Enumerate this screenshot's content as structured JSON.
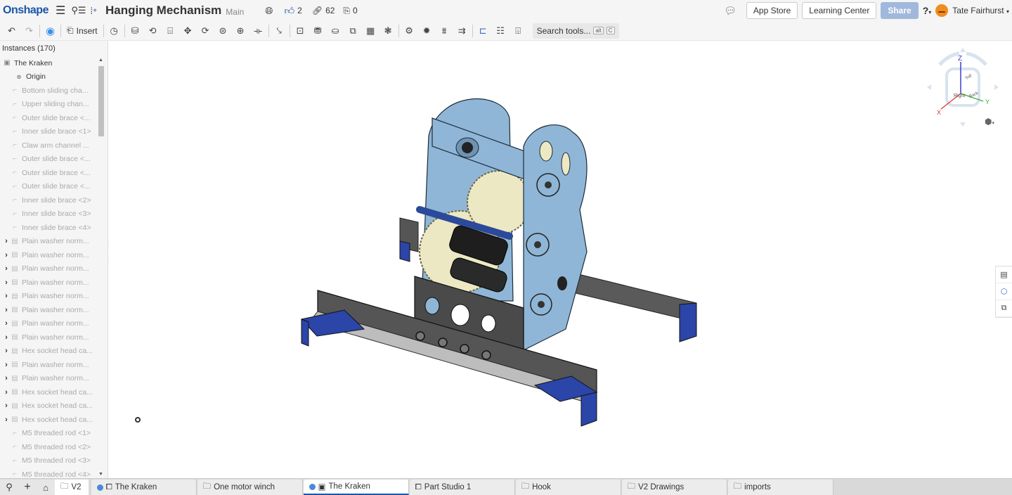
{
  "topbar": {
    "logo": "Onshape",
    "doc_title": "Hanging Mechanism",
    "branch": "Main",
    "likes": "2",
    "links": "62",
    "copies": "0",
    "app_store": "App Store",
    "learning_center": "Learning Center",
    "share": "Share",
    "user_name": "Tate Fairhurst"
  },
  "toolbar": {
    "insert_label": "Insert",
    "search_label": "Search tools...",
    "search_kbd1": "alt",
    "search_kbd2": "C"
  },
  "sidebar": {
    "header": "Instances (170)",
    "root": "The Kraken",
    "origin": "Origin",
    "items": [
      {
        "label": "Bottom sliding cha...",
        "expandable": false,
        "type": "part"
      },
      {
        "label": "Upper sliding chan...",
        "expandable": false,
        "type": "part"
      },
      {
        "label": "Outer slide brace <...",
        "expandable": false,
        "type": "part"
      },
      {
        "label": "Inner slide brace <1>",
        "expandable": false,
        "type": "part"
      },
      {
        "label": "Claw arm channel ...",
        "expandable": false,
        "type": "part"
      },
      {
        "label": "Outer slide brace <...",
        "expandable": false,
        "type": "part"
      },
      {
        "label": "Outer slide brace <...",
        "expandable": false,
        "type": "part"
      },
      {
        "label": "Outer slide brace <...",
        "expandable": false,
        "type": "part"
      },
      {
        "label": "Inner slide brace <2>",
        "expandable": false,
        "type": "part"
      },
      {
        "label": "Inner slide brace <3>",
        "expandable": false,
        "type": "part"
      },
      {
        "label": "Inner slide brace <4>",
        "expandable": false,
        "type": "part"
      },
      {
        "label": "Plain washer norm...",
        "expandable": true,
        "type": "assembly"
      },
      {
        "label": "Plain washer norm...",
        "expandable": true,
        "type": "assembly"
      },
      {
        "label": "Plain washer norm...",
        "expandable": true,
        "type": "assembly"
      },
      {
        "label": "Plain washer norm...",
        "expandable": true,
        "type": "assembly"
      },
      {
        "label": "Plain washer norm...",
        "expandable": true,
        "type": "assembly"
      },
      {
        "label": "Plain washer norm...",
        "expandable": true,
        "type": "assembly"
      },
      {
        "label": "Plain washer norm...",
        "expandable": true,
        "type": "assembly"
      },
      {
        "label": "Plain washer norm...",
        "expandable": true,
        "type": "assembly"
      },
      {
        "label": "Hex socket head ca...",
        "expandable": true,
        "type": "assembly"
      },
      {
        "label": "Plain washer norm...",
        "expandable": true,
        "type": "assembly"
      },
      {
        "label": "Plain washer norm...",
        "expandable": true,
        "type": "assembly"
      },
      {
        "label": "Hex socket head ca...",
        "expandable": true,
        "type": "assembly"
      },
      {
        "label": "Hex socket head ca...",
        "expandable": true,
        "type": "assembly"
      },
      {
        "label": "Hex socket head ca...",
        "expandable": true,
        "type": "assembly"
      },
      {
        "label": "M5 threaded rod <1>",
        "expandable": false,
        "type": "part"
      },
      {
        "label": "M5 threaded rod <2>",
        "expandable": false,
        "type": "part"
      },
      {
        "label": "M5 threaded rod <3>",
        "expandable": false,
        "type": "part"
      },
      {
        "label": "M5 threaded rod <4>",
        "expandable": false,
        "type": "part"
      }
    ]
  },
  "viewcube": {
    "z": "Z",
    "x": "X",
    "y": "Y",
    "top": "Top",
    "right": "Right",
    "back": "Back"
  },
  "bottombar": {
    "folder": "V2",
    "tabs": [
      {
        "label": "The Kraken",
        "icon": "part-studio",
        "linked": true,
        "active": false
      },
      {
        "label": "One motor winch",
        "icon": "folder",
        "linked": false,
        "active": false
      },
      {
        "label": "The Kraken",
        "icon": "assembly",
        "linked": true,
        "active": true
      },
      {
        "label": "Part Studio 1",
        "icon": "part-studio",
        "linked": false,
        "active": false
      },
      {
        "label": "Hook",
        "icon": "folder",
        "linked": false,
        "active": false
      },
      {
        "label": "V2 Drawings",
        "icon": "folder",
        "linked": false,
        "active": false
      },
      {
        "label": "imports",
        "icon": "folder",
        "linked": false,
        "active": false
      }
    ]
  },
  "colors": {
    "brand": "#1a56a8",
    "plate": "#8fb6d6",
    "gear": "#ece8c4",
    "bracket": "#2b45a8",
    "bar": "#555555"
  }
}
